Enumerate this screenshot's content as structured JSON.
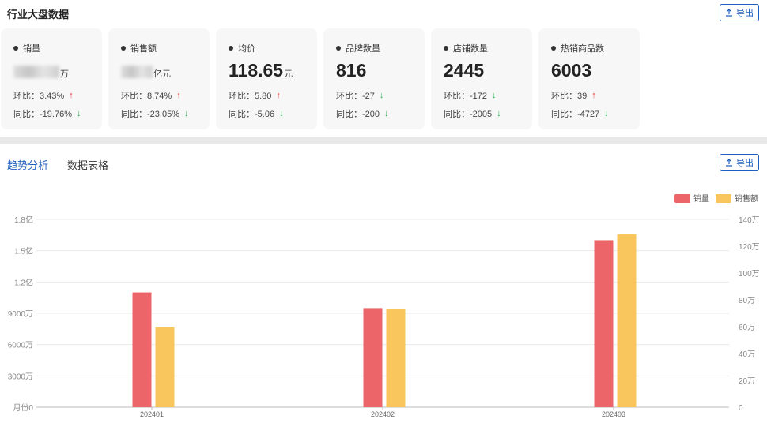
{
  "header": {
    "title": "行业大盘数据",
    "export_label": "导出"
  },
  "cards": [
    {
      "title": "销量",
      "value_suffix": "万",
      "mom": "环比：3.43%",
      "mom_dir": "up",
      "yoy": "同比：-19.76%",
      "yoy_dir": "down"
    },
    {
      "title": "销售额",
      "value_suffix": "亿元",
      "mom": "环比：8.74%",
      "mom_dir": "up",
      "yoy": "同比：-23.05%",
      "yoy_dir": "down"
    },
    {
      "title": "均价",
      "value": "118.65",
      "unit": "元",
      "mom": "环比：5.80",
      "mom_dir": "up",
      "yoy": "同比：-5.06",
      "yoy_dir": "down"
    },
    {
      "title": "品牌数量",
      "value": "816",
      "unit": "",
      "mom": "环比：-27",
      "mom_dir": "down",
      "yoy": "同比：-200",
      "yoy_dir": "down"
    },
    {
      "title": "店铺数量",
      "value": "2445",
      "unit": "",
      "mom": "环比：-172",
      "mom_dir": "down",
      "yoy": "同比：-2005",
      "yoy_dir": "down"
    },
    {
      "title": "热销商品数",
      "value": "6003",
      "unit": "",
      "mom": "环比：39",
      "mom_dir": "up",
      "yoy": "同比：-4727",
      "yoy_dir": "down"
    }
  ],
  "tabs": {
    "trend": "趋势分析",
    "table": "数据表格"
  },
  "section_export_label": "导出",
  "colors": {
    "accent": "#1f5fbf",
    "up": "#e83a3a",
    "down": "#2bb24c",
    "sales_volume": "#ec6669",
    "sales_amount": "#f8c65c"
  },
  "chart_data": {
    "type": "bar",
    "categories": [
      "202401",
      "202402",
      "202403"
    ],
    "series": [
      {
        "name": "销量",
        "axis": "left",
        "values": [
          110000000,
          95000000,
          160000000
        ]
      },
      {
        "name": "销售额",
        "axis": "right",
        "values": [
          600000,
          730000,
          1290000
        ]
      }
    ],
    "left_axis": {
      "ticks": [
        "月份0",
        "3000万",
        "6000万",
        "9000万",
        "1.2亿",
        "1.5亿",
        "1.8亿"
      ],
      "ylim": [
        0,
        180000000
      ]
    },
    "right_axis": {
      "ticks": [
        "0",
        "20万",
        "40万",
        "60万",
        "80万",
        "100万",
        "120万",
        "140万"
      ],
      "ylim": [
        0,
        1400000
      ]
    },
    "legend_position": "top-right",
    "grid": true
  }
}
